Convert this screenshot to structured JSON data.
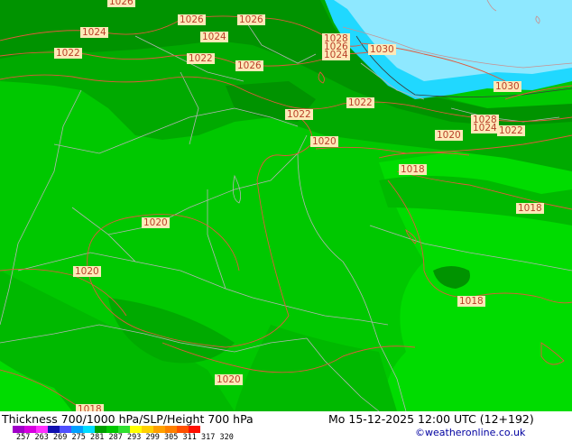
{
  "map": {
    "title": "Thickness 700/1000 hPa/SLP/Height 700 hPa",
    "datetime": "Mo 15-12-2025 12:00 UTC (12+192)",
    "credit": "©weatheronline.co.uk",
    "colors": {
      "deep_green": "#009300",
      "dark_green": "#00aa00",
      "mid_green": "#00b900",
      "light_green": "#00c800",
      "bright_green": "#00dc00",
      "cyan": "#20d8ff",
      "light_cyan": "#8ee8ff",
      "contour": "#e05a3c",
      "border": "#b4b4b4"
    }
  },
  "isobar_labels": [
    "1026",
    "1026",
    "1026",
    "1024",
    "1024",
    "1022",
    "1022",
    "1026",
    "1028",
    "1026",
    "1024",
    "1030",
    "1022",
    "1022",
    "1030",
    "1028",
    "1024",
    "1022",
    "1020",
    "1020",
    "1018",
    "1018",
    "1020",
    "1020",
    "1018",
    "1020",
    "1018"
  ],
  "colorbar": {
    "ticks": [
      "257",
      "263",
      "269",
      "275",
      "281",
      "287",
      "293",
      "299",
      "305",
      "311",
      "317",
      "320"
    ],
    "colors": [
      "#a000c8",
      "#d700e0",
      "#ff30ff",
      "#1010b0",
      "#5050ff",
      "#00a0ff",
      "#00dcff",
      "#00a000",
      "#00c800",
      "#30e030",
      "#ffff00",
      "#ffd000",
      "#ffa000",
      "#ff8000",
      "#ff5000",
      "#ff1000"
    ]
  }
}
